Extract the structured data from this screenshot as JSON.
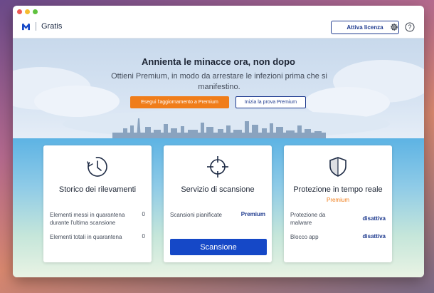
{
  "titlebar": {
    "app_name": "Gratis",
    "license_button": "Attiva licenza",
    "icons": [
      "malwarebytes-logo-icon",
      "gear-icon",
      "help-icon"
    ]
  },
  "hero": {
    "title": "Annienta le minacce ora, non dopo",
    "subtitle": "Ottieni Premium, in modo da arrestare le infezioni prima che si manifestino.",
    "upgrade_button": "Esegui l'aggiornamento a Premium",
    "trial_button": "Inizia la prova Premium"
  },
  "cards": {
    "history": {
      "title": "Storico dei rilevamenti",
      "rows": [
        {
          "label": "Elementi messi in quarantena durante l'ultima scansione",
          "value": "0"
        },
        {
          "label": "Elementi totali in quarantena",
          "value": "0"
        }
      ]
    },
    "scan": {
      "title": "Servizio di scansione",
      "rows": [
        {
          "label": "Scansioni pianificate",
          "value": "Premium"
        }
      ],
      "button": "Scansione"
    },
    "realtime": {
      "title": "Protezione in tempo reale",
      "subtitle": "Premium",
      "rows": [
        {
          "label": "Protezione da malware",
          "value": "disattiva"
        },
        {
          "label": "Blocco app",
          "value": "disattiva"
        }
      ]
    }
  },
  "colors": {
    "accent_orange": "#f07d1a",
    "primary_blue": "#1548c7",
    "link_blue": "#1f3b8f"
  }
}
